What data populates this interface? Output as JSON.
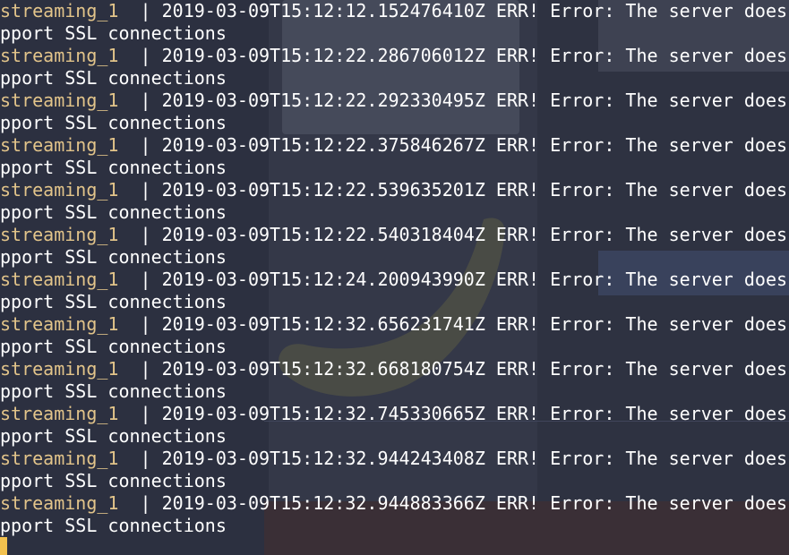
{
  "colors": {
    "terminal_bg": "#2f3342",
    "service_name": "#e2c48a",
    "log_text": "#ffffff",
    "cursor": "#f2c14e"
  },
  "terminal": {
    "lines": [
      {
        "service": "streaming_1",
        "separator": "|",
        "timestamp": "2019-03-09T15:12:12.152476410Z",
        "message_start": "ERR! Error: The server does not su",
        "message_end": "pport SSL connections"
      },
      {
        "service": "streaming_1",
        "separator": "|",
        "timestamp": "2019-03-09T15:12:22.286706012Z",
        "message_start": "ERR! Error: The server does not su",
        "message_end": "pport SSL connections"
      },
      {
        "service": "streaming_1",
        "separator": "|",
        "timestamp": "2019-03-09T15:12:22.292330495Z",
        "message_start": "ERR! Error: The server does not su",
        "message_end": "pport SSL connections"
      },
      {
        "service": "streaming_1",
        "separator": "|",
        "timestamp": "2019-03-09T15:12:22.375846267Z",
        "message_start": "ERR! Error: The server does not su",
        "message_end": "pport SSL connections"
      },
      {
        "service": "streaming_1",
        "separator": "|",
        "timestamp": "2019-03-09T15:12:22.539635201Z",
        "message_start": "ERR! Error: The server does not su",
        "message_end": "pport SSL connections"
      },
      {
        "service": "streaming_1",
        "separator": "|",
        "timestamp": "2019-03-09T15:12:22.540318404Z",
        "message_start": "ERR! Error: The server does not su",
        "message_end": "pport SSL connections"
      },
      {
        "service": "streaming_1",
        "separator": "|",
        "timestamp": "2019-03-09T15:12:24.200943990Z",
        "message_start": "ERR! Error: The server does not su",
        "message_end": "pport SSL connections"
      },
      {
        "service": "streaming_1",
        "separator": "|",
        "timestamp": "2019-03-09T15:12:32.656231741Z",
        "message_start": "ERR! Error: The server does not su",
        "message_end": "pport SSL connections"
      },
      {
        "service": "streaming_1",
        "separator": "|",
        "timestamp": "2019-03-09T15:12:32.668180754Z",
        "message_start": "ERR! Error: The server does not su",
        "message_end": "pport SSL connections"
      },
      {
        "service": "streaming_1",
        "separator": "|",
        "timestamp": "2019-03-09T15:12:32.745330665Z",
        "message_start": "ERR! Error: The server does not su",
        "message_end": "pport SSL connections"
      },
      {
        "service": "streaming_1",
        "separator": "|",
        "timestamp": "2019-03-09T15:12:32.944243408Z",
        "message_start": "ERR! Error: The server does not su",
        "message_end": "pport SSL connections"
      },
      {
        "service": "streaming_1",
        "separator": "|",
        "timestamp": "2019-03-09T15:12:32.944883366Z",
        "message_start": "ERR! Error: The server does not su",
        "message_end": "pport SSL connections"
      }
    ]
  }
}
